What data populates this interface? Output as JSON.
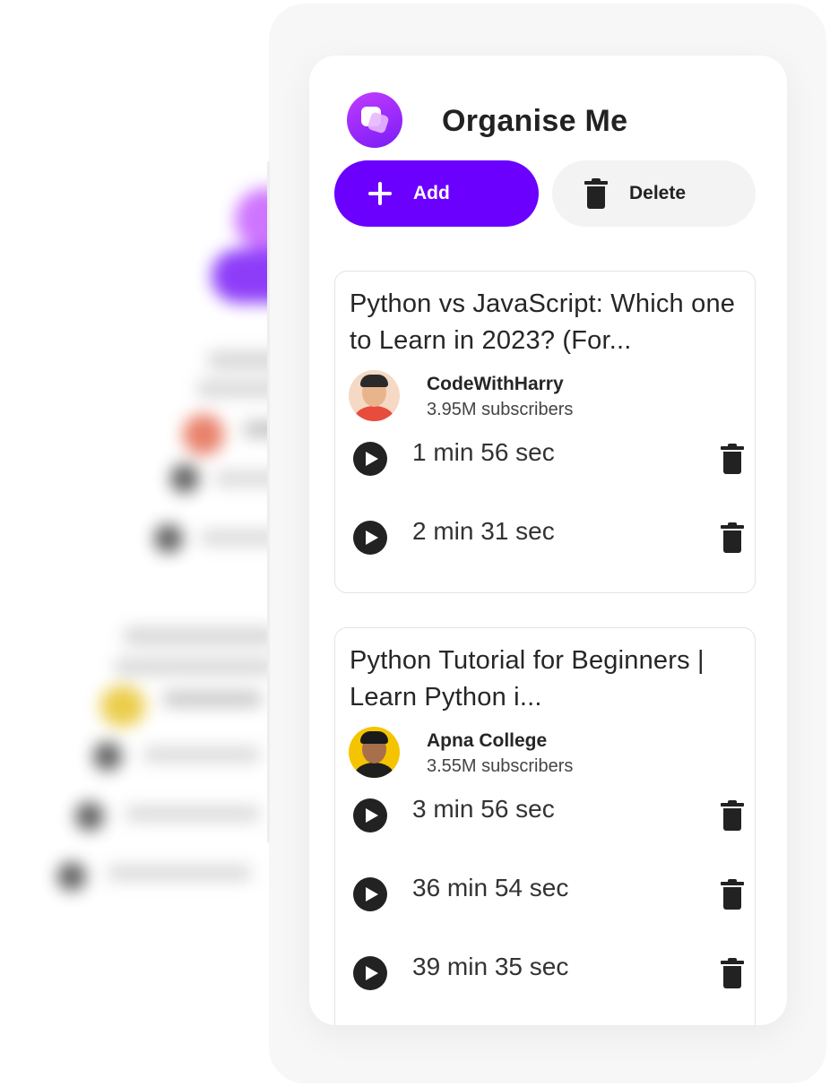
{
  "app": {
    "title": "Organise Me",
    "brand_icon": "organise-me-logo-icon",
    "accent_color": "#6b00ff"
  },
  "toolbar": {
    "add_label": "Add",
    "add_icon": "plus-icon",
    "delete_label": "Delete",
    "delete_icon": "trash-icon"
  },
  "playlists": [
    {
      "title": "Python vs JavaScript: Which one to Learn in 2023? (For...",
      "channel": "CodeWithHarry",
      "subscribers": "3.95M subscribers",
      "avatar_color": "#e74c3c",
      "clips": [
        {
          "duration": "1 min 56 sec"
        },
        {
          "duration": "2 min 31 sec"
        }
      ]
    },
    {
      "title": "Python Tutorial for Beginners | Learn Python i...",
      "channel": "Apna College",
      "subscribers": "3.55M subscribers",
      "avatar_color": "#f5c400",
      "clips": [
        {
          "duration": "3 min 56 sec"
        },
        {
          "duration": "36 min 54 sec"
        },
        {
          "duration": "39 min 35 sec"
        }
      ]
    }
  ]
}
